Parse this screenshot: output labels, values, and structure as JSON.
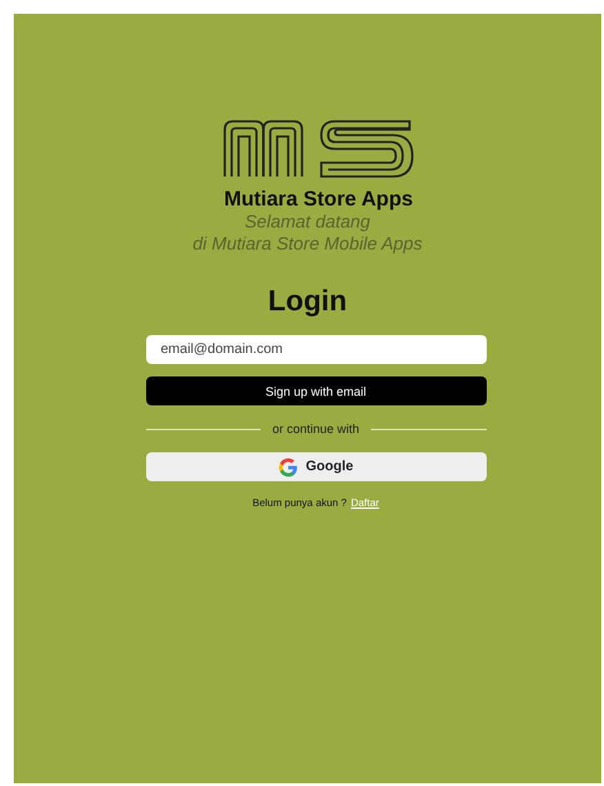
{
  "app_name": "Mutiara Store Apps",
  "welcome": [
    "Selamat datang",
    "di Mutiara Store Mobile Apps"
  ],
  "heading": "Login",
  "email_field": {
    "placeholder": "email@domain.com"
  },
  "signup_button": "Sign up with email",
  "divider_text": "or continue with",
  "google_button": "Google",
  "footer": {
    "text": "Belum punya akun ?",
    "link": "Daftar"
  }
}
